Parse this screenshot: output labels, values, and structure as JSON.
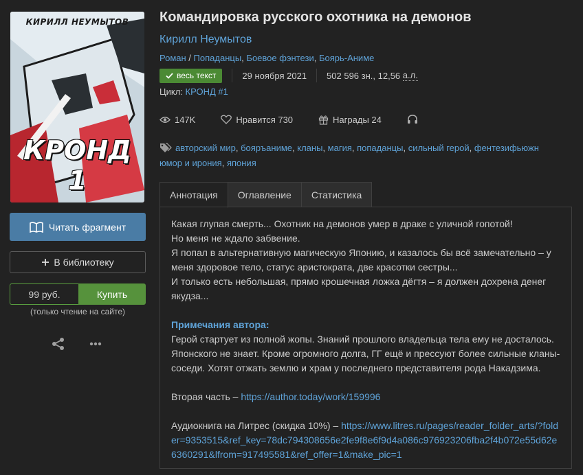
{
  "cover": {
    "author_text": "КИРИЛЛ НЕУМЫТОВ",
    "title_text": "КРОНД 1"
  },
  "left": {
    "read_label": "Читать фрагмент",
    "library_label": "В библиотеку",
    "price": "99 руб.",
    "buy_label": "Купить",
    "price_note": "(только чтение на сайте)"
  },
  "book": {
    "title": "Командировка русского охотника на демонов",
    "author": "Кирилл Неумытов",
    "genre_main": "Роман",
    "genre_sep": " / ",
    "genres": [
      "Попаданцы",
      "Боевое фэнтези",
      "Боярь-Аниме"
    ],
    "badge": "весь текст",
    "date": "29 ноября 2021",
    "size": "502 596 зн., 12,56",
    "size_unit": "а.л.",
    "cycle_label": "Цикл: ",
    "cycle_value": "КРОНД #1"
  },
  "stats": {
    "views": "147K",
    "likes": "Нравится 730",
    "awards": "Награды 24"
  },
  "tags": [
    "авторский мир",
    "бояръаниме",
    "кланы",
    "магия",
    "попаданцы",
    "сильный герой",
    "фентезифьюжн",
    "юмор и ирония",
    "япония"
  ],
  "tabs": [
    "Аннотация",
    "Оглавление",
    "Статистика"
  ],
  "annotation": {
    "text": "Какая глупая смерть... Охотник на демонов умер в драке с уличной гопотой!\nНо меня не ждало забвение.\nЯ попал в альтернативную магическую Японию, и казалось бы всё замечательно – у меня здоровое тело, статус аристократа, две красотки сестры...\nИ только есть небольшая, прямо крошечная ложка дёгтя – я должен дохрена денег якудза...",
    "notes_title": "Примечания автора:",
    "notes_text": "Герой стартует из полной жопы. Знаний прошлого владельца тела ему не досталось. Японского не знает. Кроме огромного долга, ГГ ещё и прессуют более сильные кланы-соседи. Хотят отжать землю и храм у последнего представителя рода Накадзима.",
    "second_part_label": "Вторая часть – ",
    "second_part_link": "https://author.today/work/159996",
    "audio_label": "Аудиокнига на Литрес (скидка 10%) – ",
    "audio_link": "https://www.litres.ru/pages/reader_folder_arts/?folder=9353515&ref_key=78dc794308656e2fe9f8e6f9d4a086c976923206fba2f4b072e55d62e6360291&lfrom=917495581&ref_offer=1&make_pic=1"
  }
}
